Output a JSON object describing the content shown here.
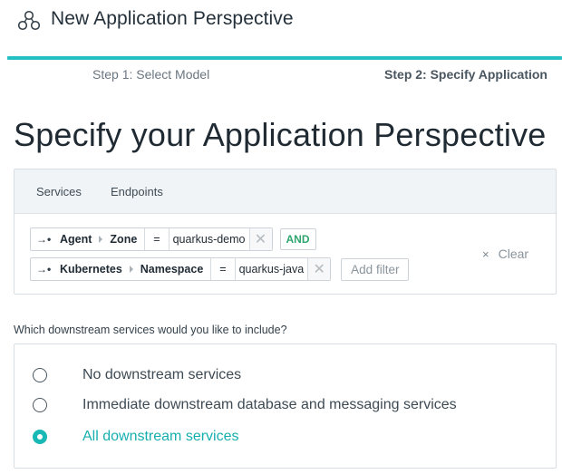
{
  "header": {
    "title": "New Application Perspective",
    "icon": "application-perspective-icon"
  },
  "progress": {
    "fraction": 1.0,
    "color": "#25c0c4"
  },
  "steps": [
    {
      "label": "Step 1: Select Model",
      "active": false
    },
    {
      "label": "Step 2: Specify Application",
      "active": true
    }
  ],
  "page_title": "Specify your Application Perspective",
  "filter_tabs": {
    "services": "Services",
    "endpoints": "Endpoints"
  },
  "filters": {
    "row1": {
      "entity": "Agent",
      "attribute": "Zone",
      "operator": "=",
      "value": "quarkus-demo",
      "remove": "✕",
      "connector": "AND"
    },
    "row2": {
      "entity": "Kubernetes",
      "attribute": "Namespace",
      "operator": "=",
      "value": "quarkus-java",
      "remove": "✕"
    },
    "add_filter": "Add filter",
    "arrow_glyph": "→•",
    "clear": {
      "icon": "×",
      "label": "Clear"
    }
  },
  "downstream": {
    "question": "Which downstream services would you like to include?",
    "options": [
      {
        "label": "No downstream services",
        "checked": false
      },
      {
        "label": "Immediate downstream database and messaging services",
        "checked": false
      },
      {
        "label": "All downstream services",
        "checked": true
      }
    ],
    "accent": "#17b8b5"
  }
}
